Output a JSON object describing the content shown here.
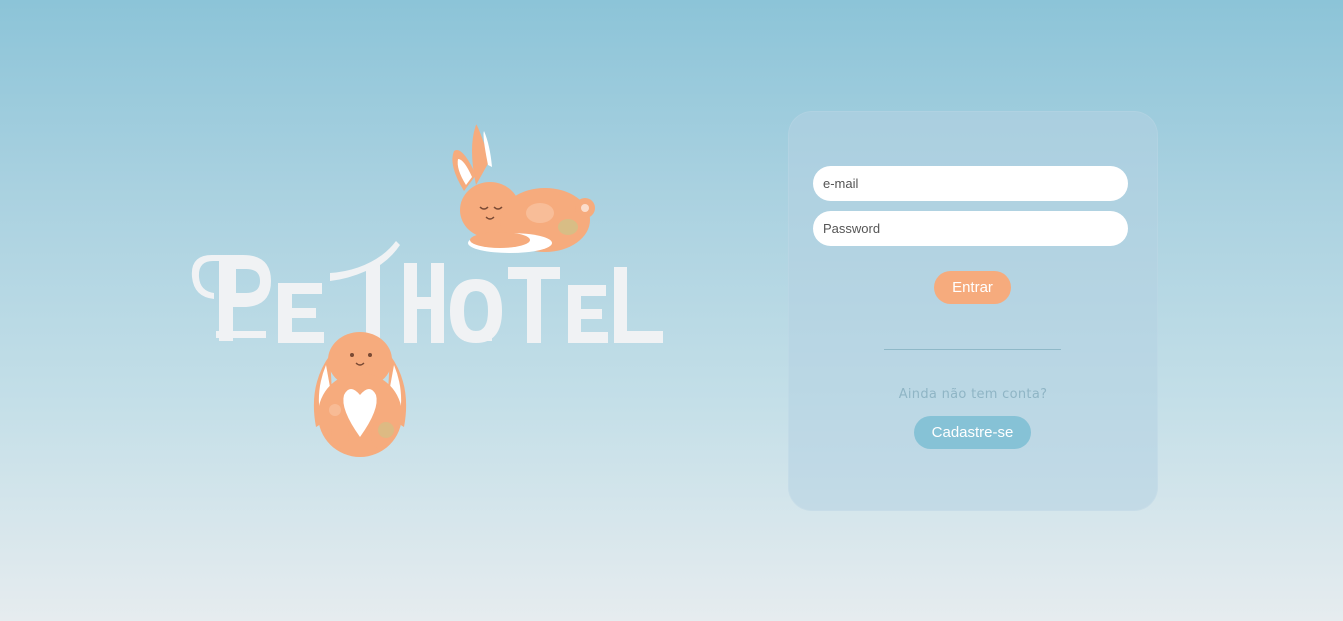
{
  "logo": {
    "text": "PET HOTEL",
    "letter_color": "#f0f2f4",
    "bunny_color": "#f6ab7d"
  },
  "login": {
    "email_placeholder": "e-mail",
    "password_placeholder": "Password",
    "submit_label": "Entrar",
    "submit_color": "#f6ab7d"
  },
  "signup": {
    "prompt": "Ainda não tem conta?",
    "button_label": "Cadastre-se",
    "button_color": "#86c2d6"
  }
}
